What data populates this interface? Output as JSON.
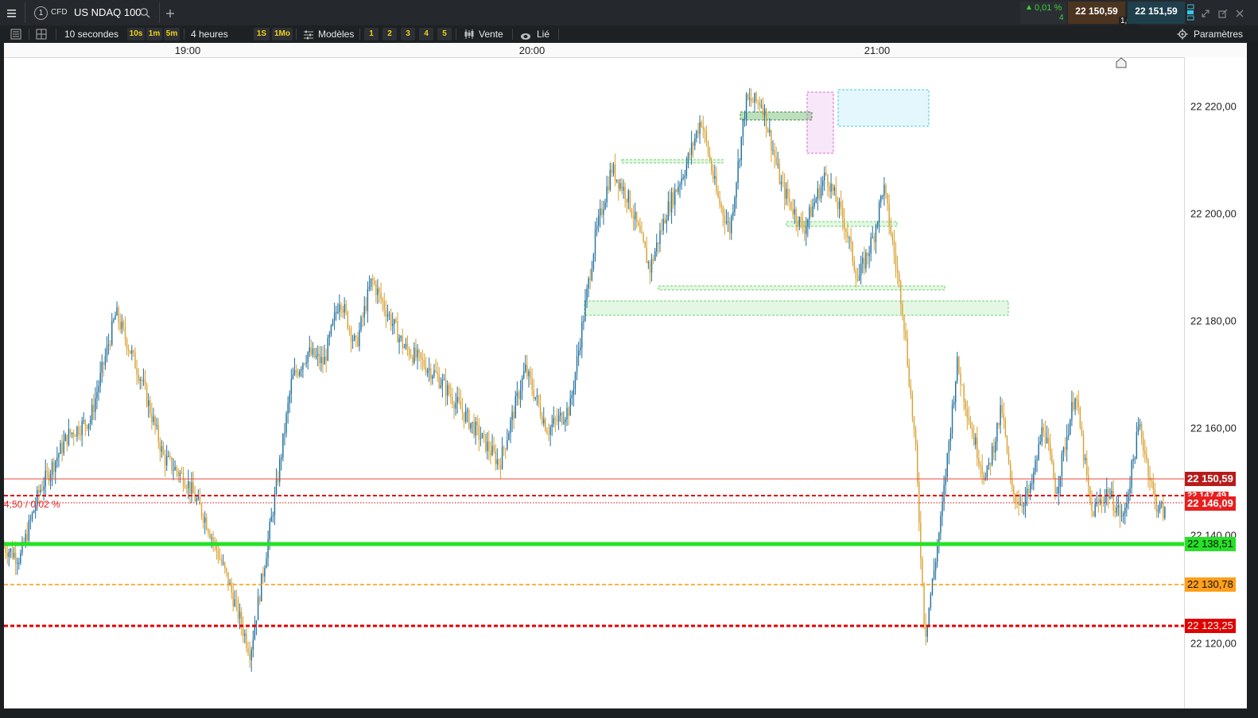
{
  "app": {
    "menu_icon": "hamburger-icon",
    "tab_number": "1",
    "instrument_type": "CFD",
    "instrument_name": "US NDAQ 100",
    "change_pct": "0,01 %",
    "change_count": "4",
    "sell_price": "22 150,59",
    "buy_price": "22 151,59",
    "spread": "1,00"
  },
  "toolbar": {
    "interval": "10 secondes",
    "quick_intervals": [
      "10s",
      "1m",
      "5m"
    ],
    "range": "4 heures",
    "quick_ranges": [
      "1S",
      "1Mo"
    ],
    "templates": "Modèles",
    "layouts": [
      "1",
      "2",
      "3",
      "4",
      "5"
    ],
    "sell": "Vente",
    "linked": "Lié",
    "settings": "Paramètres"
  },
  "chart_data": {
    "type": "line",
    "instrument": "US NDAQ 100",
    "x_ticks": [
      "19:00",
      "20:00",
      "21:00"
    ],
    "y_ticks": [
      "22 220,00",
      "22 200,00",
      "22 180,00",
      "22 160,00",
      "22 140,00",
      "22 120,00"
    ],
    "ylim": [
      22111,
      22228
    ],
    "x_range_minutes": [
      18.15,
      21.84
    ],
    "series": [
      {
        "x": [
          18.15,
          18.2,
          18.26,
          18.35,
          18.42,
          18.5,
          18.58,
          18.65,
          18.72,
          18.78,
          18.85,
          18.92,
          19.0,
          19.05,
          19.1,
          19.15,
          19.2,
          19.25,
          19.3,
          19.4,
          19.5,
          19.6,
          19.7,
          19.78,
          19.85,
          19.92,
          20.0,
          20.05,
          20.1,
          20.17,
          20.22,
          20.28,
          20.33,
          20.38,
          20.42,
          20.47,
          20.52,
          20.58,
          20.65,
          20.72,
          20.78,
          20.82,
          20.87,
          20.9,
          20.96,
          21.0,
          21.03,
          21.08,
          21.13,
          21.18,
          21.22,
          21.27,
          21.3,
          21.33,
          21.36,
          21.4,
          21.44,
          21.5,
          21.55,
          21.6,
          21.65,
          21.7,
          21.75,
          21.78
        ],
        "y": [
          22140,
          22138,
          22150,
          22160,
          22163,
          22182,
          22170,
          22156,
          22152,
          22145,
          22134,
          22121,
          22150,
          22170,
          22175,
          22173,
          22185,
          22176,
          22188,
          22176,
          22171,
          22163,
          22155,
          22172,
          22161,
          22165,
          22196,
          22208,
          22203,
          22190,
          22200,
          22208,
          22217,
          22203,
          22197,
          22220,
          22220,
          22205,
          22197,
          22207,
          22198,
          22188,
          22196,
          22205,
          22183,
          22158,
          22124,
          22145,
          22173,
          22160,
          22152,
          22165,
          22150,
          22148,
          22150,
          22162,
          22150,
          22168,
          22146,
          22150,
          22145,
          22162,
          22148,
          22146
        ]
      }
    ]
  },
  "price_lines": {
    "current_sell": "22 150,59",
    "order_1": "22 147,49",
    "order_2": "22 146,09",
    "order_note": "4,50 / 0,02 %",
    "support_green": "22 138,51",
    "level_orange": "22 130,78",
    "level_red": "22 123,25"
  },
  "colors": {
    "candle_up": "#1f6f9f",
    "candle_down": "#d9a030",
    "sell_tag": "#b71c1c",
    "order_tag": "#e81f1f",
    "support": "#27e027",
    "orange": "#ff9800",
    "red_dashed": "#e00000",
    "zone_green": "#6ad46a",
    "zone_pink": "#d66bd6",
    "zone_blue": "#49c7ee"
  }
}
